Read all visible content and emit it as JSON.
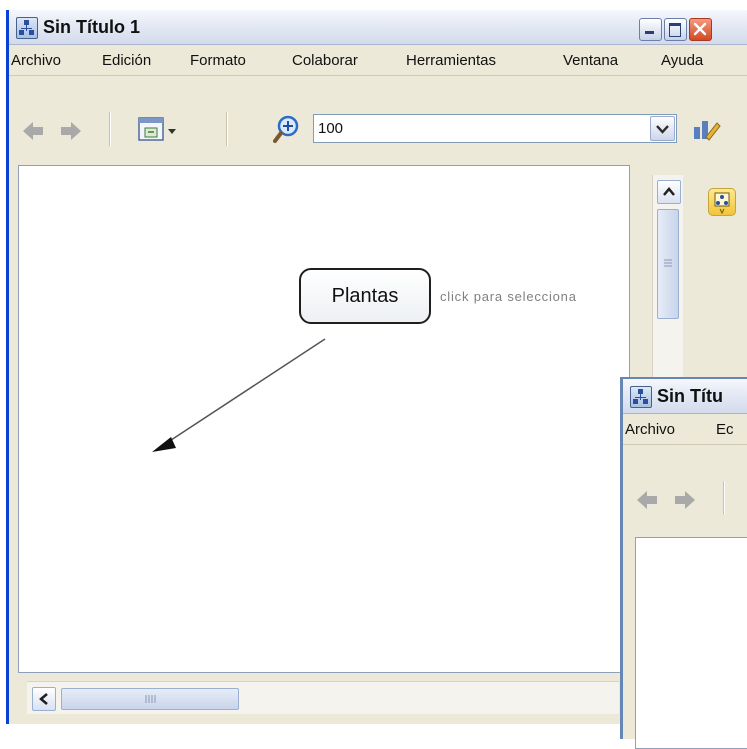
{
  "main_window": {
    "title": "Sin Título 1",
    "menu": [
      "Archivo",
      "Edición",
      "Formato",
      "Colaborar",
      "Herramientas",
      "Ventana",
      "Ayuda"
    ],
    "zoom_value": "100",
    "canvas": {
      "node_label": "Plantas",
      "hint_text": "click para selecciona"
    },
    "scroll": {
      "v_up": "▲",
      "h_left": "◀"
    }
  },
  "second_window": {
    "title": "Sin Títu",
    "menu": [
      "Archivo",
      "Ec"
    ]
  },
  "colors": {
    "titlebar": "#e4e9f5",
    "window_bg": "#ece9d8",
    "accent_blue": "#0842d4",
    "close_red": "#d24a24",
    "icon_yellow": "#f2c43a"
  },
  "icons": [
    "app-icon",
    "minimize-icon",
    "maximize-icon",
    "close-icon",
    "back-arrow-icon",
    "forward-arrow-icon",
    "view-map-icon",
    "zoom-in-icon",
    "chevron-down-icon",
    "edit-icon",
    "collaborate-icon",
    "arrow-icon"
  ]
}
